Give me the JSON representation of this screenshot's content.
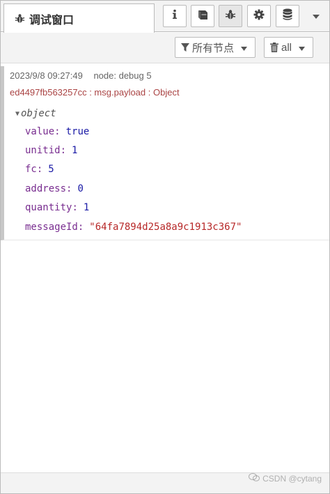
{
  "header": {
    "active_tab_label": "调试窗口",
    "icons": [
      "info-icon",
      "book-icon",
      "bug-icon",
      "gear-icon",
      "database-icon",
      "caret-down-icon"
    ]
  },
  "toolbar": {
    "filter_label": "所有节点",
    "clear_label": "all"
  },
  "message": {
    "timestamp": "2023/9/8 09:27:49",
    "node": "node: debug 5",
    "source": "ed4497fb563257cc : msg.payload : Object",
    "root_type": "object",
    "properties": [
      {
        "key": "value",
        "value": "true",
        "type": "boolean"
      },
      {
        "key": "unitid",
        "value": "1",
        "type": "number"
      },
      {
        "key": "fc",
        "value": "5",
        "type": "number"
      },
      {
        "key": "address",
        "value": "0",
        "type": "number"
      },
      {
        "key": "quantity",
        "value": "1",
        "type": "number"
      },
      {
        "key": "messageId",
        "value": "\"64fa7894d25a8a9c1913c367\"",
        "type": "string"
      }
    ]
  },
  "watermark": {
    "text": "CSDN @cytang"
  },
  "colors": {
    "key": "#792e90",
    "number": "#1a1aa6",
    "string": "#b72828",
    "source": "#a44444"
  }
}
